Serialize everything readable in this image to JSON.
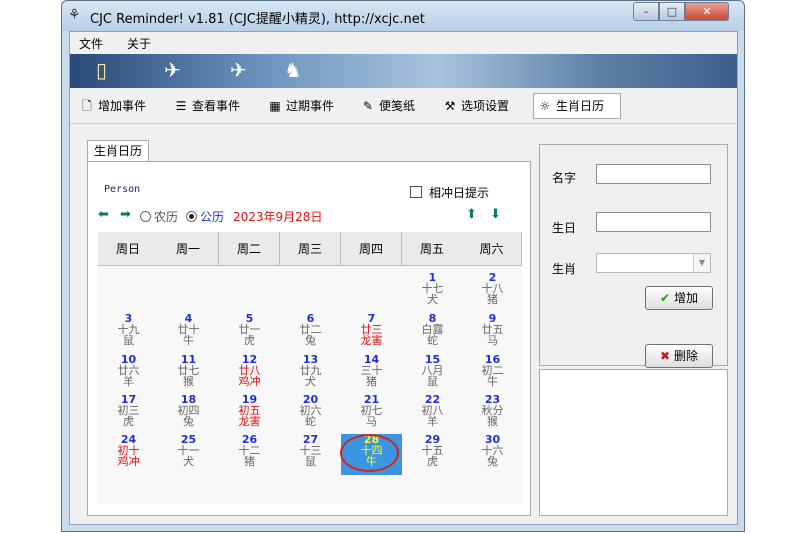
{
  "window": {
    "title": "CJC Reminder! v1.81 (CJC提醒小精灵),  http://xcjc.net",
    "app_icon": "bird-icon",
    "minimize": "–",
    "maximize": "□",
    "close": "✕"
  },
  "menu": [
    {
      "label": "文件"
    },
    {
      "label": "关于"
    }
  ],
  "banner": {
    "icons": [
      "door-exit-icon",
      "dove-icon",
      "dove-icon",
      "horse-icon"
    ]
  },
  "toolbar": [
    {
      "label": "增加事件",
      "icon": "new-page-icon"
    },
    {
      "label": "查看事件",
      "icon": "list-icon"
    },
    {
      "label": "过期事件",
      "icon": "calendar-icon"
    },
    {
      "label": "便笺纸",
      "icon": "pen-icon"
    },
    {
      "label": "选项设置",
      "icon": "tools-icon"
    },
    {
      "label": "生肖日历",
      "icon": "sun-icon",
      "active": true
    }
  ],
  "calendar_tab": {
    "label": "生肖日历"
  },
  "person_label": "Person",
  "conflict_reminder": {
    "label": "相冲日提示",
    "checked": false
  },
  "calendar_nav": {
    "lunar_label": "农历",
    "solar_label": "公历",
    "selected_mode": "公历",
    "current_date": "2023年9月28日"
  },
  "weekdays": [
    "周日",
    "周一",
    "周二",
    "周三",
    "周四",
    "周五",
    "周六"
  ],
  "days": [
    {
      "day": "1",
      "l1": "十七",
      "l2": "犬",
      "col": 5,
      "row": 0
    },
    {
      "day": "2",
      "l1": "十八",
      "l2": "猪",
      "col": 6,
      "row": 0
    },
    {
      "day": "3",
      "l1": "十九",
      "l2": "鼠",
      "col": 0,
      "row": 1
    },
    {
      "day": "4",
      "l1": "廿十",
      "l2": "牛",
      "col": 1,
      "row": 1
    },
    {
      "day": "5",
      "l1": "廿一",
      "l2": "虎",
      "col": 2,
      "row": 1
    },
    {
      "day": "6",
      "l1": "廿二",
      "l2": "兔",
      "col": 3,
      "row": 1
    },
    {
      "day": "7",
      "l1": "廿三",
      "l2": "龙害",
      "col": 4,
      "row": 1,
      "red": true
    },
    {
      "day": "8",
      "l1": "白露",
      "l2": "蛇",
      "col": 5,
      "row": 1
    },
    {
      "day": "9",
      "l1": "廿五",
      "l2": "马",
      "col": 6,
      "row": 1
    },
    {
      "day": "10",
      "l1": "廿六",
      "l2": "羊",
      "col": 0,
      "row": 2
    },
    {
      "day": "11",
      "l1": "廿七",
      "l2": "猴",
      "col": 1,
      "row": 2
    },
    {
      "day": "12",
      "l1": "廿八",
      "l2": "鸡冲",
      "col": 2,
      "row": 2,
      "red": true
    },
    {
      "day": "13",
      "l1": "廿九",
      "l2": "犬",
      "col": 3,
      "row": 2
    },
    {
      "day": "14",
      "l1": "三十",
      "l2": "猪",
      "col": 4,
      "row": 2
    },
    {
      "day": "15",
      "l1": "八月",
      "l2": "鼠",
      "col": 5,
      "row": 2
    },
    {
      "day": "16",
      "l1": "初二",
      "l2": "牛",
      "col": 6,
      "row": 2
    },
    {
      "day": "17",
      "l1": "初三",
      "l2": "虎",
      "col": 0,
      "row": 3
    },
    {
      "day": "18",
      "l1": "初四",
      "l2": "兔",
      "col": 1,
      "row": 3
    },
    {
      "day": "19",
      "l1": "初五",
      "l2": "龙害",
      "col": 2,
      "row": 3,
      "red": true
    },
    {
      "day": "20",
      "l1": "初六",
      "l2": "蛇",
      "col": 3,
      "row": 3
    },
    {
      "day": "21",
      "l1": "初七",
      "l2": "马",
      "col": 4,
      "row": 3
    },
    {
      "day": "22",
      "l1": "初八",
      "l2": "羊",
      "col": 5,
      "row": 3
    },
    {
      "day": "23",
      "l1": "秋分",
      "l2": "猴",
      "col": 6,
      "row": 3
    },
    {
      "day": "24",
      "l1": "初十",
      "l2": "鸡冲",
      "col": 0,
      "row": 4,
      "red": true
    },
    {
      "day": "25",
      "l1": "十一",
      "l2": "犬",
      "col": 1,
      "row": 4
    },
    {
      "day": "26",
      "l1": "十二",
      "l2": "猪",
      "col": 2,
      "row": 4
    },
    {
      "day": "27",
      "l1": "十三",
      "l2": "鼠",
      "col": 3,
      "row": 4
    },
    {
      "day": "28",
      "l1": "十四",
      "l2": "牛",
      "col": 4,
      "row": 4,
      "selected": true
    },
    {
      "day": "29",
      "l1": "十五",
      "l2": "虎",
      "col": 5,
      "row": 4
    },
    {
      "day": "30",
      "l1": "十六",
      "l2": "兔",
      "col": 6,
      "row": 4
    }
  ],
  "form": {
    "name_label": "名字",
    "name_value": "",
    "birthday_label": "生日",
    "birthday_value": "",
    "zodiac_label": "生肖",
    "zodiac_value": "",
    "add_label": "增加",
    "add_icon": "checkmark-icon",
    "delete_label": "删除",
    "delete_icon": "x-icon"
  },
  "colors": {
    "accent_blue": "#1f2fd8",
    "conflict_red": "#d11111",
    "selected_bg": "#3b95e0",
    "selected_text": "#fff52e",
    "nav_arrow": "#0a7a6a"
  }
}
